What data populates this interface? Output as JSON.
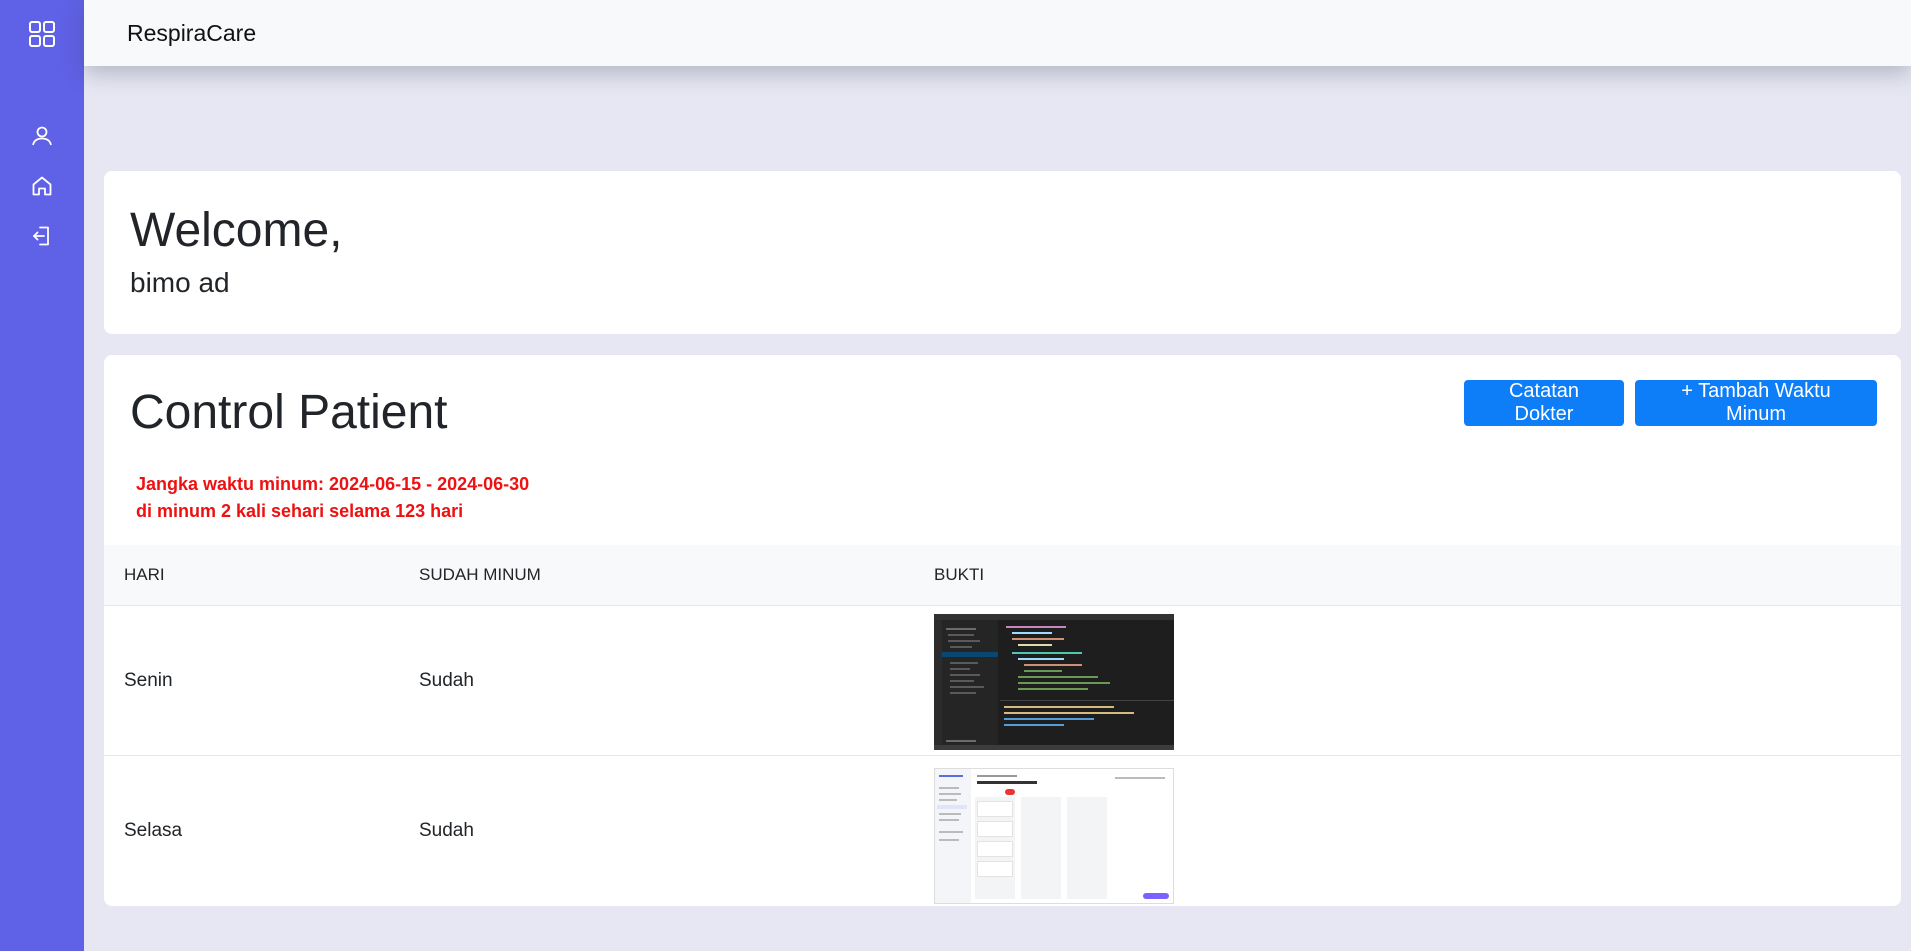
{
  "app": {
    "brand": "RespiraCare"
  },
  "sidebar": {
    "icons": [
      "grid-icon",
      "user-icon",
      "home-icon",
      "logout-icon"
    ]
  },
  "welcome": {
    "title": "Welcome,",
    "name": "bimo ad"
  },
  "control": {
    "title": "Control Patient",
    "buttons": {
      "notes": "Catatan Dokter",
      "add": "+ Tambah Waktu Minum"
    },
    "info_line1": "Jangka waktu minum: 2024-06-15 - 2024-06-30",
    "info_line2": "di minum 2 kali sehari selama 123 hari",
    "table": {
      "headers": [
        "HARI",
        "SUDAH MINUM",
        "BUKTI"
      ],
      "rows": [
        {
          "day": "Senin",
          "status": "Sudah",
          "proof": "code-editor-screenshot"
        },
        {
          "day": "Selasa",
          "status": "Sudah",
          "proof": "kanban-app-screenshot"
        }
      ]
    }
  },
  "colors": {
    "sidebar": "#5f61e6",
    "primary_button": "#0d7ef8",
    "warning_text": "#ee1111",
    "page_background": "#e6e7f2"
  }
}
